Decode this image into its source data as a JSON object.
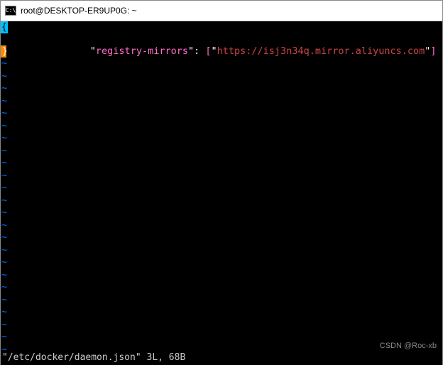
{
  "titlebar": {
    "icon_text": "C:\\",
    "title": "root@DESKTOP-ER9UP0G: ~"
  },
  "editor": {
    "line1_marker": "{",
    "line2_marker": "}",
    "content": {
      "key_quote_open": "\"",
      "key": "registry-mirrors",
      "key_quote_close": "\"",
      "colon_space": ": ",
      "bracket_open": "[",
      "str_quote_open": "\"",
      "url": "https://isj3n34q.mirror.aliyuncs.com",
      "str_quote_close": "\"",
      "bracket_close": "]"
    },
    "tilde": "~",
    "tilde_count": 24
  },
  "status": {
    "text": "\"/etc/docker/daemon.json\" 3L, 68B"
  },
  "watermark": {
    "text": "CSDN @Roc-xb"
  }
}
